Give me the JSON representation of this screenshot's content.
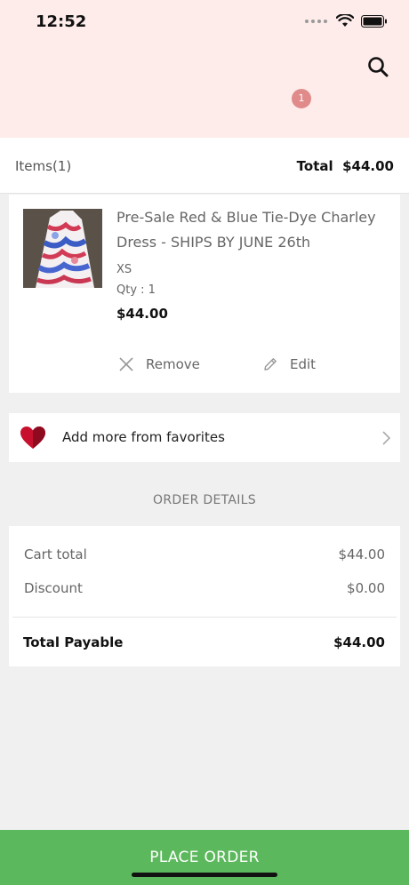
{
  "status_bar": {
    "time": "12:52"
  },
  "header": {
    "cart_badge_count": "1"
  },
  "summary": {
    "items_label": "Items",
    "items_count": "(1)",
    "total_label": "Total",
    "total_value": "$44.00"
  },
  "cart_items": [
    {
      "title": "Pre-Sale Red & Blue Tie-Dye Charley Dress - SHIPS BY JUNE 26th",
      "size": "XS",
      "qty": "Qty : 1",
      "price": "$44.00",
      "remove_label": "Remove",
      "edit_label": "Edit"
    }
  ],
  "favorites": {
    "label": "Add more from favorites"
  },
  "order_details": {
    "heading": "ORDER DETAILS",
    "cart_total_label": "Cart total",
    "cart_total_value": "$44.00",
    "discount_label": "Discount",
    "discount_value": "$0.00",
    "payable_label": "Total Payable",
    "payable_value": "$44.00"
  },
  "footer": {
    "place_order_label": "PLACE ORDER"
  },
  "colors": {
    "header_bg": "#fdecea",
    "badge": "#e08a8a",
    "place_order": "#5cb85c",
    "heart": "#c8102e"
  },
  "icons": [
    "search-icon",
    "close-icon",
    "pencil-icon",
    "heart-icon",
    "chevron-right-icon",
    "wifi-icon",
    "battery-icon"
  ]
}
